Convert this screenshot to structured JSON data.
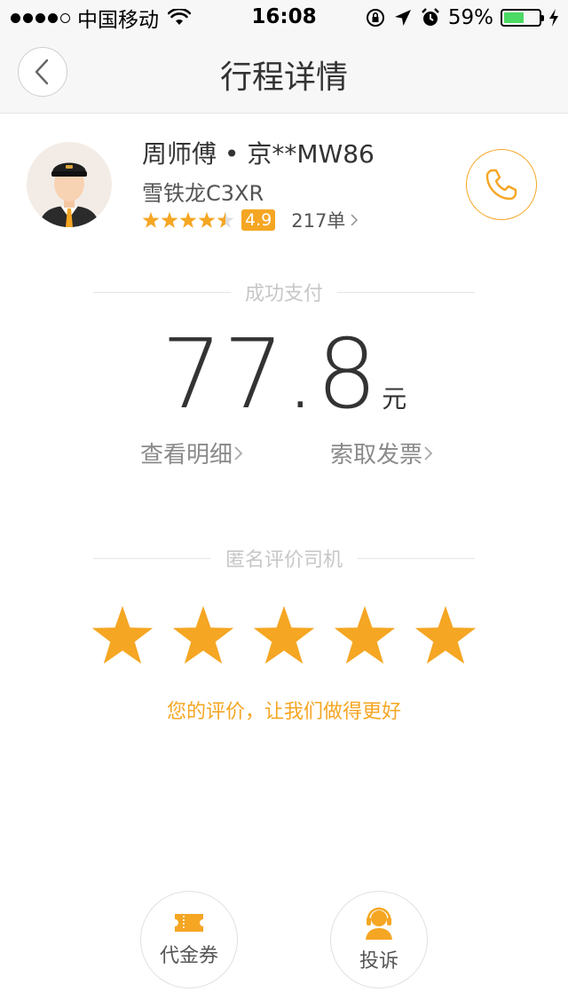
{
  "status_bar": {
    "carrier": "中国移动",
    "time": "16:08",
    "battery": "59%",
    "battery_level": 0.59,
    "icons": [
      "signal-dots-icon",
      "wifi-icon",
      "orientation-lock-icon",
      "location-arrow-icon",
      "alarm-icon",
      "battery-icon",
      "charging-icon"
    ]
  },
  "nav": {
    "title": "行程详情",
    "back_icon": "chevron-left-icon"
  },
  "driver": {
    "name": "周师傅",
    "separator": "•",
    "plate": "京**MW86",
    "car": "雪铁龙C3XR",
    "star_rating": 4.5,
    "rating": "4.9",
    "orders": "217单",
    "phone_icon": "phone-icon"
  },
  "payment": {
    "status": "成功支付",
    "amount": "77.8",
    "unit": "元",
    "detail_link": "查看明细",
    "invoice_link": "索取发票"
  },
  "review": {
    "heading": "匿名评价司机",
    "prompt": "您的评价，让我们做得更好",
    "stars": 5
  },
  "actions": {
    "coupon": "代金券",
    "complaint": "投诉"
  },
  "colors": {
    "accent": "#f5a623",
    "text": "#333333",
    "muted": "#8a8a8a",
    "divider_text": "#c7c7c7",
    "battery": "#4cd964"
  }
}
